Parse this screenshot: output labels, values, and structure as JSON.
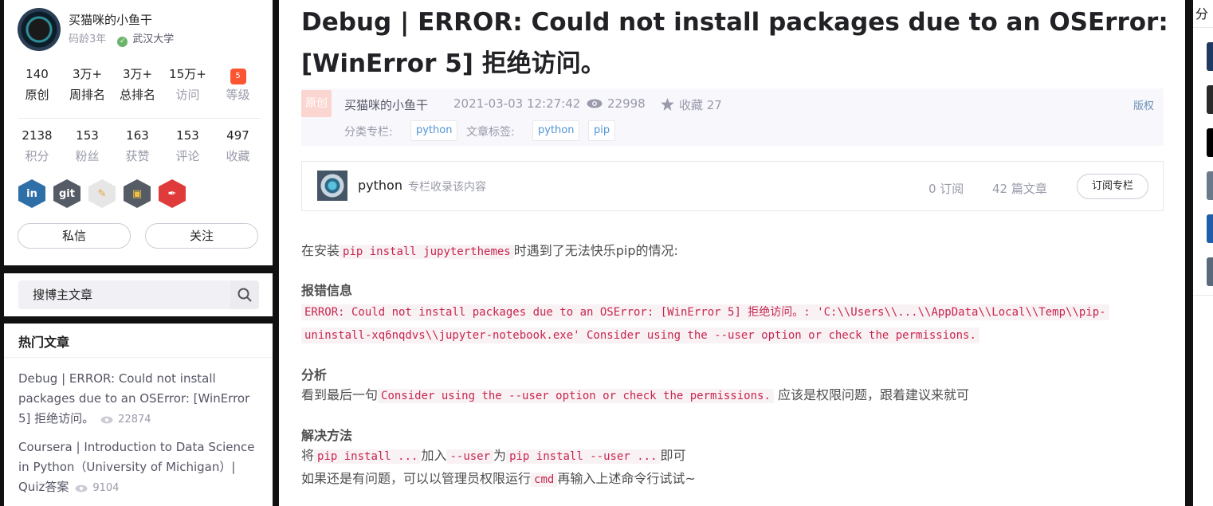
{
  "profile": {
    "name": "买猫咪的小鱼干",
    "code_age": "码龄3年",
    "school": "武汉大学",
    "row1": [
      {
        "num": "140",
        "label": "原创"
      },
      {
        "num": "3万+",
        "label": "周排名"
      },
      {
        "num": "3万+",
        "label": "总排名"
      },
      {
        "num": "15万+",
        "label": "访问"
      },
      {
        "num": "",
        "label": "等级"
      }
    ],
    "row2": [
      {
        "num": "2138",
        "label": "积分"
      },
      {
        "num": "153",
        "label": "粉丝"
      },
      {
        "num": "163",
        "label": "获赞"
      },
      {
        "num": "153",
        "label": "评论"
      },
      {
        "num": "497",
        "label": "收藏"
      }
    ],
    "level_icon_text": "5",
    "badges": [
      "in",
      "git",
      "✎",
      "▣",
      "✒"
    ],
    "message_button": "私信",
    "follow_button": "关注"
  },
  "search": {
    "placeholder": "搜博主文章"
  },
  "hot": {
    "title": "热门文章",
    "items": [
      {
        "title": "Debug | ERROR: Could not install packages due to an OSError: [WinError 5] 拒绝访问。",
        "views": "22874"
      },
      {
        "title": "Coursera | Introduction to Data Science in Python（University of Michigan）| Quiz答案",
        "views": "9104"
      }
    ]
  },
  "article": {
    "title": "Debug | ERROR: Could not install packages due to an OSError: [WinError 5] 拒绝访问。",
    "original_badge": "原创",
    "author": "买猫咪的小鱼干",
    "time": "2021-03-03 12:27:42",
    "views": "22998",
    "favorites": "收藏 27",
    "copyright": "版权",
    "category_label": "分类专栏:",
    "category": "python",
    "tags_label": "文章标签:",
    "tags": [
      "python",
      "pip"
    ],
    "column": {
      "name": "python",
      "desc": "专栏收录该内容",
      "subs": "0 订阅",
      "articles": "42 篇文章",
      "subscribe_button": "订阅专栏"
    },
    "p1_pre": "在安装",
    "p1_code": "pip install jupyterthemes",
    "p1_post": "时遇到了无法快乐pip的情况:",
    "h_error": "报错信息",
    "error_line1": "ERROR: Could not install packages due to an OSError: [WinError 5] 拒绝访问。: 'C:\\\\Users\\\\...\\\\AppData\\\\Local\\\\Temp\\\\pip-",
    "error_line2": "uninstall-xq6nqdvs\\\\jupyter-notebook.exe' Consider using the --user option or check the permissions.",
    "h_analysis": "分析",
    "a_pre": "看到最后一句",
    "a_code": "Consider using the --user option or check the permissions.",
    "a_post": "应该是权限问题，跟着建议来就可",
    "h_solution": "解决方法",
    "s_pre": "将",
    "s_code1": "pip install ...",
    "s_mid1": "加入",
    "s_code2": "--user",
    "s_mid2": "为",
    "s_code3": "pip install --user ...",
    "s_post": "即可",
    "s2_pre": "如果还是有问题，可以以管理员权限运行",
    "s2_code": "cmd",
    "s2_post": "再输入上述命令行试试~"
  },
  "right": {
    "top_char": "分"
  },
  "colors": {
    "accent": "#fc5531",
    "code": "#c7254e",
    "link": "#5094d5"
  }
}
